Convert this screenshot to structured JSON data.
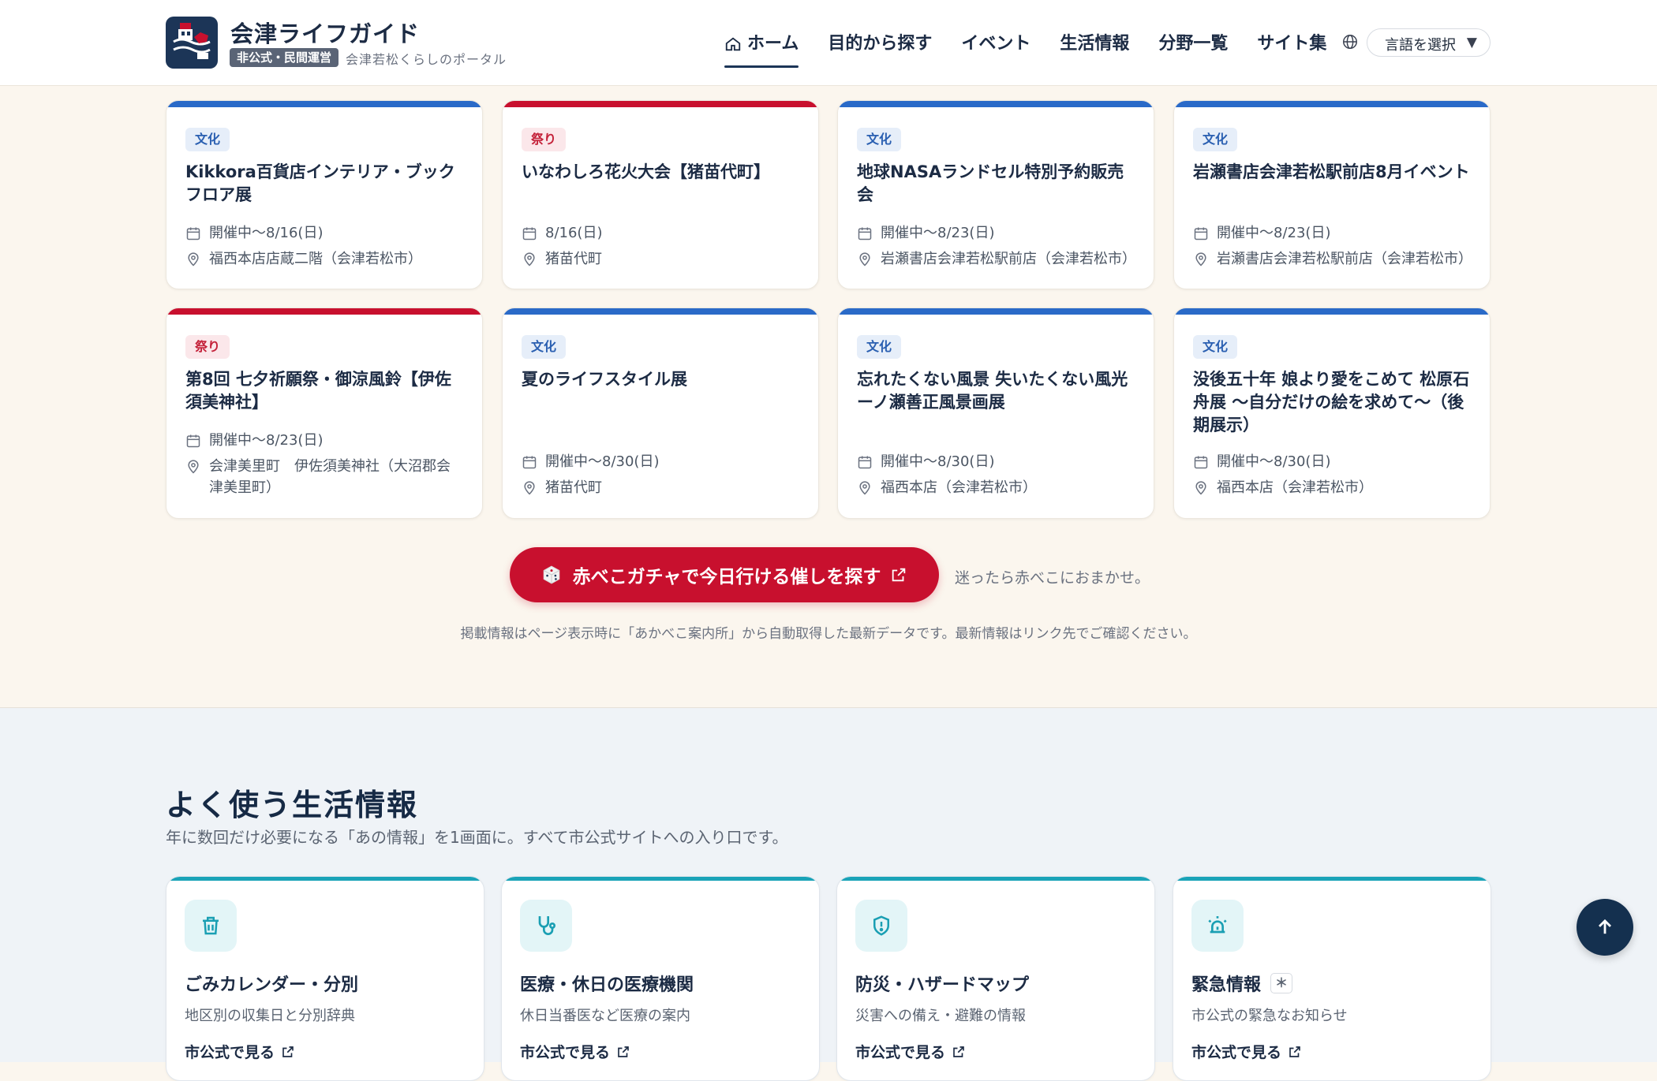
{
  "header": {
    "site_title": "会津ライフガイド",
    "badge": "非公式・民間運営",
    "tagline": "会津若松くらしのポータル",
    "nav": [
      {
        "label": "ホーム",
        "active": true
      },
      {
        "label": "目的から探す"
      },
      {
        "label": "イベント"
      },
      {
        "label": "生活情報"
      },
      {
        "label": "分野一覧"
      },
      {
        "label": "サイト集"
      }
    ],
    "language_select": "言語を選択"
  },
  "colors": {
    "blue_bar": "#2a6ac8",
    "red_bar": "#c8102e",
    "teal_bar": "#1aa3b8",
    "brand_navy": "#1c3557"
  },
  "events": [
    {
      "category": "文化",
      "title": "Kikkora百貨店インテリア・ブックフロア展",
      "date": "開催中〜8/16(日)",
      "place": "福西本店店蔵二階（会津若松市）"
    },
    {
      "category": "祭り",
      "title": "いなわしろ花火大会【猪苗代町】",
      "date": "8/16(日)",
      "place": "猪苗代町"
    },
    {
      "category": "文化",
      "title": "地球NASAランドセル特別予約販売会",
      "date": "開催中〜8/23(日)",
      "place": "岩瀬書店会津若松駅前店（会津若松市）"
    },
    {
      "category": "文化",
      "title": "岩瀬書店会津若松駅前店8月イベント",
      "date": "開催中〜8/23(日)",
      "place": "岩瀬書店会津若松駅前店（会津若松市）"
    },
    {
      "category": "祭り",
      "title": "第8回 七夕祈願祭・御涼風鈴【伊佐須美神社】",
      "date": "開催中〜8/23(日)",
      "place": "会津美里町　伊佐須美神社（大沼郡会津美里町）"
    },
    {
      "category": "文化",
      "title": "夏のライフスタイル展",
      "date": "開催中〜8/30(日)",
      "place": "猪苗代町"
    },
    {
      "category": "文化",
      "title": "忘れたくない風景 失いたくない風光ーノ瀬善正風景画展",
      "date": "開催中〜8/30(日)",
      "place": "福西本店（会津若松市）"
    },
    {
      "category": "文化",
      "title": "没後五十年 娘より愛をこめて 松原石舟展 〜自分だけの絵を求めて〜（後期展示）",
      "date": "開催中〜8/30(日)",
      "place": "福西本店（会津若松市）"
    }
  ],
  "gacha": {
    "button_label": "赤べこガチャで今日行ける催しを探す",
    "note": "迷ったら赤べこにおまかせ。",
    "disclaimer": "掲載情報はページ表示時に「あかべこ案内所」から自動取得した最新データです。最新情報はリンク先でご確認ください。"
  },
  "life": {
    "title": "よく使う生活情報",
    "subtitle": "年に数回だけ必要になる「あの情報」を1画面に。すべて市公式サイトへの入り口です。",
    "cards": [
      {
        "icon": "trash-icon",
        "title": "ごみカレンダー・分別",
        "desc": "地区別の収集日と分別辞典",
        "link": "市公式で見る"
      },
      {
        "icon": "stethoscope-icon",
        "title": "医療・休日の医療機関",
        "desc": "休日当番医など医療の案内",
        "link": "市公式で見る"
      },
      {
        "icon": "shield-icon",
        "title": "防災・ハザードマップ",
        "desc": "災害への備え・避難の情報",
        "link": "市公式で見る"
      },
      {
        "icon": "siren-icon",
        "title": "緊急情報",
        "badge": "＊",
        "desc": "市公式の緊急なお知らせ",
        "link": "市公式で見る"
      }
    ]
  }
}
